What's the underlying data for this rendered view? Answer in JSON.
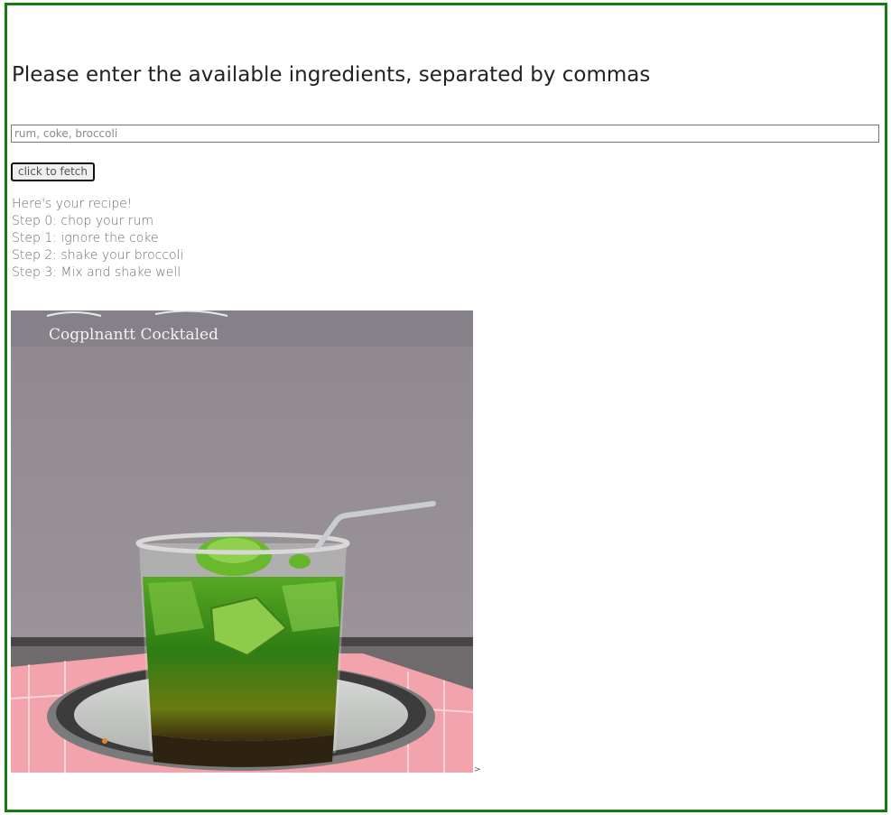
{
  "prompt": {
    "heading": "Please enter the available ingredients, separated by commas"
  },
  "search": {
    "placeholder": "rum, coke, broccoli",
    "value": ""
  },
  "fetch_button": {
    "label": "click to fetch"
  },
  "recipe": {
    "intro": "Here's your recipe!",
    "steps": [
      "Step 0: chop your rum",
      "Step 1: ignore the coke",
      "Step 2: shake your broccoli",
      "Step 3: Mix and shake well"
    ]
  },
  "image": {
    "caption_text": "Cogplnantt Cocktaled"
  },
  "trailing_glyph": ">",
  "colors": {
    "frame_border": "#137d13",
    "drink_green": "#3f8f1a",
    "backdrop": "#908890"
  }
}
